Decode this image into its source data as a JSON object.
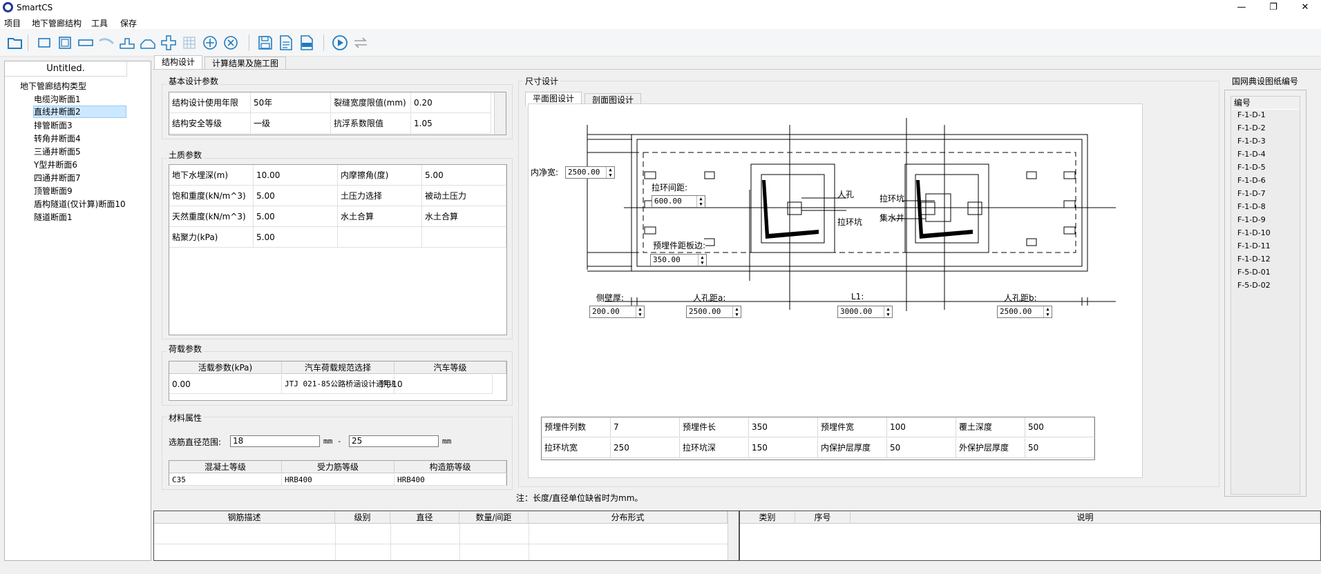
{
  "app": {
    "title": "SmartCS"
  },
  "menu": [
    "项目",
    "地下管廊结构",
    "工具",
    "保存"
  ],
  "tree": {
    "header": "Untitled.",
    "root": "地下管廊结构类型",
    "items": [
      "电缆沟断面1",
      "直线井断面2",
      "排管断面3",
      "转角井断面4",
      "三通井断面5",
      "Y型井断面6",
      "四通井断面7",
      "顶管断面9",
      "盾构隧道(仅计算)断面10",
      "隧道断面1"
    ],
    "selected_index": 1
  },
  "tabs": {
    "main": [
      "结构设计",
      "计算结果及施工图"
    ],
    "dim": [
      "平面图设计",
      "剖面图设计"
    ]
  },
  "basic": {
    "title": "基本设计参数",
    "rows": [
      [
        "结构设计使用年限",
        "50年",
        "裂缝宽度限值(mm)",
        "0.20"
      ],
      [
        "结构安全等级",
        "一级",
        "抗浮系数限值",
        "1.05"
      ]
    ]
  },
  "soil": {
    "title": "土质参数",
    "rows": [
      [
        "地下水埋深(m)",
        "10.00",
        "内摩擦角(度)",
        "5.00"
      ],
      [
        "饱和重度(kN/m^3)",
        "5.00",
        "土压力选择",
        "被动土压力"
      ],
      [
        "天然重度(kN/m^3)",
        "5.00",
        "水土合算",
        "水土合算"
      ],
      [
        "粘聚力(kPa)",
        "5.00",
        "",
        ""
      ]
    ]
  },
  "load": {
    "title": "荷载参数",
    "headers": [
      "活载参数(kPa)",
      "汽车荷载规范选择",
      "汽车等级"
    ],
    "row": [
      "0.00",
      "JTJ 021-85公路桥涵设计通用规范",
      "汽-10"
    ]
  },
  "material": {
    "title": "材料属性",
    "range_label": "选筋直径范围:",
    "min": "18",
    "max": "25",
    "unit": "mm",
    "dash": "mm -",
    "headers": [
      "混凝土等级",
      "受力筋等级",
      "构造筋等级"
    ],
    "row": [
      "C35",
      "HRB400",
      "HRB400"
    ]
  },
  "dimension": {
    "title": "尺寸设计",
    "labels": {
      "inner_width": "内净宽:",
      "ring_spacing": "拉环间距:",
      "embed_edge": "预埋件距板边:",
      "manhole": "人孔",
      "pull_pit": "拉环坑",
      "pull_pit2": "拉环坑",
      "sump": "集水井",
      "side_wall": "侧壁厚:",
      "manhole_a": "人孔距a:",
      "l1": "L1:",
      "manhole_b": "人孔距b:"
    },
    "values": {
      "inner_width": "2500.00",
      "ring_spacing": "600.00",
      "embed_edge": "350.00",
      "side_wall": "200.00",
      "manhole_a": "2500.00",
      "l1": "3000.00",
      "manhole_b": "2500.00"
    },
    "params": [
      [
        "预埋件列数",
        "7",
        "预埋件长",
        "350",
        "预埋件宽",
        "100",
        "覆土深度",
        "500"
      ],
      [
        "拉环坑宽",
        "250",
        "拉环坑深",
        "150",
        "内保护层厚度",
        "50",
        "外保护层厚度",
        "50"
      ]
    ],
    "note": "注：长度/直径单位缺省时为mm。"
  },
  "codes": {
    "title": "国网典设图纸编号",
    "header": "编号",
    "items": [
      "F-1-D-1",
      "F-1-D-2",
      "F-1-D-3",
      "F-1-D-4",
      "F-1-D-5",
      "F-1-D-6",
      "F-1-D-7",
      "F-1-D-8",
      "F-1-D-9",
      "F-1-D-10",
      "F-1-D-11",
      "F-1-D-12",
      "F-5-D-01",
      "F-5-D-02"
    ]
  },
  "rebar_table": {
    "headers": [
      "钢筋描述",
      "级别",
      "直径",
      "数量/间距",
      "分布形式"
    ]
  },
  "info_table": {
    "headers": [
      "类别",
      "序号",
      "说明"
    ]
  },
  "colors": {
    "accent": "#1f7bc1",
    "selection": "#cce8ff",
    "logo": "#203a8f"
  }
}
